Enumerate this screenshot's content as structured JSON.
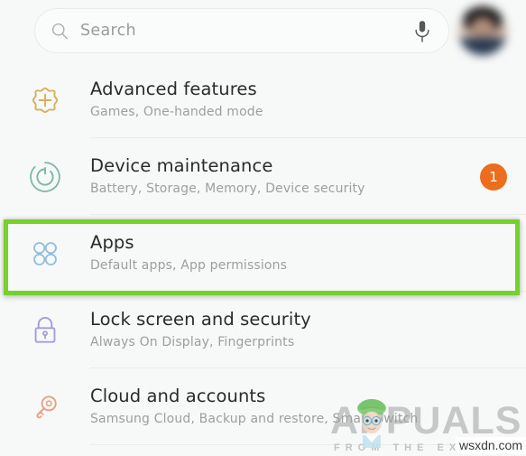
{
  "search": {
    "placeholder": "Search",
    "search_icon": "search-icon",
    "mic_icon": "microphone-icon",
    "avatar": "user-avatar"
  },
  "settings": {
    "items": [
      {
        "title": "Advanced features",
        "subtitle": "Games, One-handed mode",
        "icon": "gear-plus-icon",
        "icon_color": "#d6b05a",
        "badge": null
      },
      {
        "title": "Device maintenance",
        "subtitle": "Battery, Storage, Memory, Device security",
        "icon": "refresh-circle-icon",
        "icon_color": "#7cb8a8",
        "badge": "1",
        "badge_color": "#ed6d1e"
      },
      {
        "title": "Apps",
        "subtitle": "Default apps, App permissions",
        "icon": "four-circles-icon",
        "icon_color": "#8ec0dd",
        "badge": null,
        "highlighted": true,
        "highlight_color": "#76d128"
      },
      {
        "title": "Lock screen and security",
        "subtitle": "Always On Display, Fingerprints",
        "icon": "padlock-icon",
        "icon_color": "#a39ddb",
        "badge": null
      },
      {
        "title": "Cloud and accounts",
        "subtitle": "Samsung Cloud, Backup and restore, Smart Switch",
        "icon": "key-icon",
        "icon_color": "#e8a184",
        "badge": null
      }
    ]
  },
  "watermark": {
    "brand": "APPUALS",
    "tagline": "FROM THE EXPERTS",
    "site": "wsxdn.com"
  }
}
